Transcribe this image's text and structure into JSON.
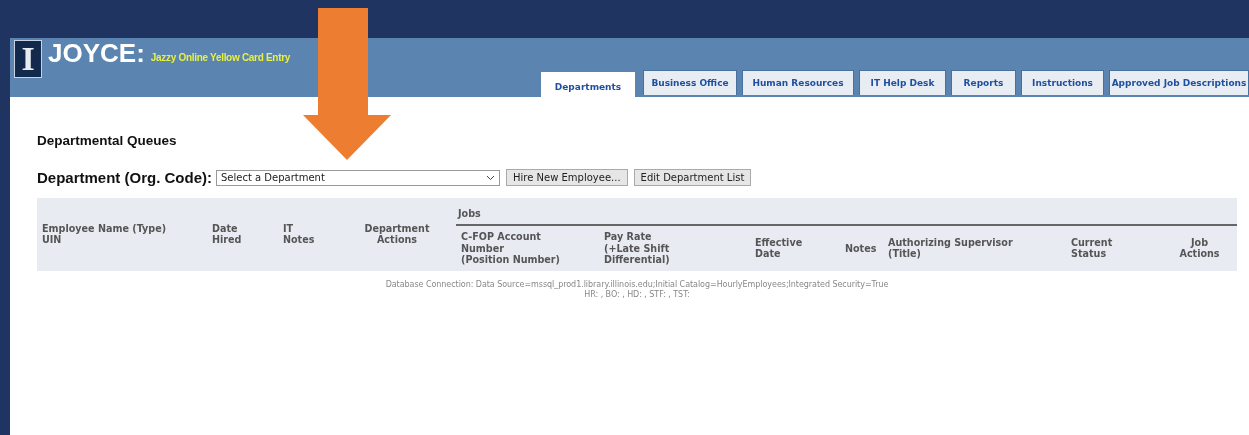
{
  "header": {
    "logo": "I",
    "title": "JOYCE:",
    "subtitle": "Jazzy Online Yellow Card Entry"
  },
  "tabs": [
    {
      "label": "Departments",
      "selected": true
    },
    {
      "label": "Business Office",
      "selected": false
    },
    {
      "label": "Human Resources",
      "selected": false
    },
    {
      "label": "IT Help Desk",
      "selected": false
    },
    {
      "label": "Reports",
      "selected": false
    },
    {
      "label": "Instructions",
      "selected": false
    },
    {
      "label": "Approved Job Descriptions",
      "selected": false
    }
  ],
  "section_title": "Departmental Queues",
  "department": {
    "label": "Department (Org. Code):",
    "value": "Select a Department"
  },
  "buttons": [
    "Hire New Employee...",
    "Edit Department List"
  ],
  "table": {
    "columns": [
      {
        "lines": [
          "Employee Name (Type)",
          "UIN"
        ]
      },
      {
        "lines": [
          "Date",
          "Hired"
        ]
      },
      {
        "lines": [
          "IT",
          "Notes"
        ]
      },
      {
        "lines": [
          "Department",
          "Actions"
        ]
      }
    ],
    "group": {
      "header": "Jobs",
      "columns": [
        {
          "lines": [
            "C-FOP Account",
            "Number",
            "(Position Number)"
          ]
        },
        {
          "lines": [
            "Pay Rate",
            "(+Late Shift",
            "Differential)"
          ]
        },
        {
          "lines": [
            "Effective",
            "Date"
          ]
        },
        {
          "lines": [
            "Notes"
          ]
        },
        {
          "lines": [
            "Authorizing Supervisor",
            "(Title)"
          ]
        },
        {
          "lines": [
            "Current",
            "Status"
          ]
        },
        {
          "lines": [
            "Job",
            "Actions"
          ]
        }
      ]
    }
  },
  "footer": [
    "Database Connection: Data Source=mssql_prod1.library.illinois.edu;Initial Catalog=HourlyEmployees;Integrated Security=True",
    "HR: , BO: , HD: , STF: , TST:"
  ]
}
